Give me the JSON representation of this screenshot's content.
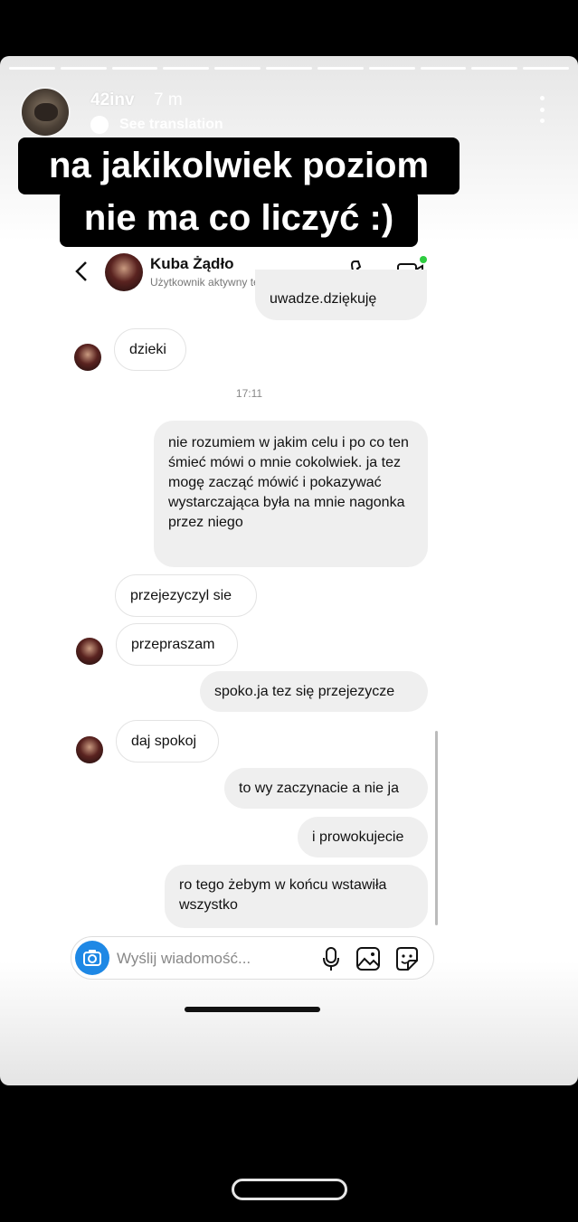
{
  "story": {
    "username": "42inv",
    "time": "7 m",
    "translate_label": "See translation",
    "caption_line1": "na jakikolwiek poziom",
    "caption_line2": "nie ma co liczyć :)"
  },
  "chat": {
    "contact_name": "Kuba Żądło",
    "contact_status": "Użytkownik aktywny teraz",
    "timestamp": "17:11",
    "messages": [
      {
        "side": "out",
        "text": "uwadze.dziękuję"
      },
      {
        "side": "in",
        "text": "dzieki"
      },
      {
        "side": "out",
        "text": "nie rozumiem w jakim celu i po co ten śmieć mówi o mnie cokolwiek. ja tez mogę zacząć mówić i pokazywać wystarczająca była na mnie nagonka przez niego"
      },
      {
        "side": "in",
        "text": "przejezyczyl sie"
      },
      {
        "side": "in",
        "text": "przepraszam"
      },
      {
        "side": "out",
        "text": "spoko.ja tez się przejezycze"
      },
      {
        "side": "in",
        "text": "daj spokoj"
      },
      {
        "side": "out",
        "text": "to wy zaczynacie a nie ja"
      },
      {
        "side": "out",
        "text": "i prowokujecie"
      },
      {
        "side": "out",
        "text": "ro tego żebym w końcu wstawiła wszystko"
      }
    ],
    "composer_placeholder": "Wyślij wiadomość..."
  },
  "colors": {
    "camera_button": "#1e88e5",
    "active_dot": "#2ecc40",
    "outgoing_bubble": "#efefef"
  }
}
